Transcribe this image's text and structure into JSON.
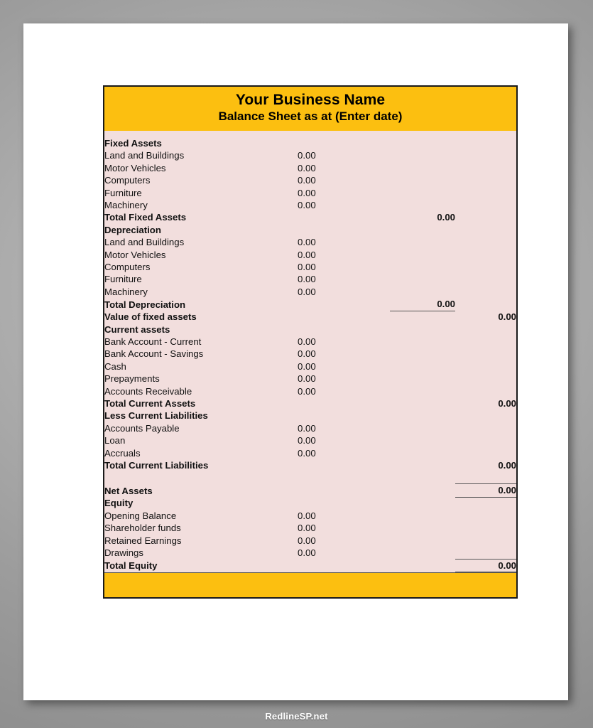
{
  "header": {
    "business_name": "Your Business Name",
    "subtitle": "Balance Sheet as at (Enter date)",
    "band_color": "#fcbf10",
    "body_color": "#f2dedd"
  },
  "sections": [
    {
      "title": "Fixed Assets",
      "rows": [
        {
          "label": "Land and Buildings",
          "detail": "0.00"
        },
        {
          "label": "Motor Vehicles",
          "detail": "0.00"
        },
        {
          "label": "Computers",
          "detail": "0.00"
        },
        {
          "label": "Furniture",
          "detail": "0.00"
        },
        {
          "label": "Machinery",
          "detail": "0.00"
        }
      ],
      "total": {
        "label": "Total Fixed Assets",
        "sub": "0.00"
      }
    },
    {
      "title": "Depreciation",
      "rows": [
        {
          "label": "Land and Buildings",
          "detail": "0.00"
        },
        {
          "label": "Motor Vehicles",
          "detail": "0.00"
        },
        {
          "label": "Computers",
          "detail": "0.00"
        },
        {
          "label": "Furniture",
          "detail": "0.00"
        },
        {
          "label": "Machinery",
          "detail": "0.00"
        }
      ],
      "total": {
        "label": "Total Depreciation",
        "sub": "0.00"
      },
      "grand": {
        "label": "Value of fixed assets",
        "total": "0.00"
      }
    },
    {
      "title": "Current assets",
      "rows": [
        {
          "label": "Bank Account - Current",
          "detail": "0.00"
        },
        {
          "label": "Bank Account - Savings",
          "detail": "0.00"
        },
        {
          "label": "Cash",
          "detail": "0.00"
        },
        {
          "label": "Prepayments",
          "detail": "0.00"
        },
        {
          "label": "Accounts Receivable",
          "detail": "0.00"
        }
      ],
      "total": {
        "label": "Total Current Assets",
        "total": "0.00"
      }
    },
    {
      "title": "Less Current Liabilities",
      "rows": [
        {
          "label": "Accounts Payable",
          "detail": "0.00"
        },
        {
          "label": "Loan",
          "detail": "0.00"
        },
        {
          "label": "Accruals",
          "detail": "0.00"
        }
      ],
      "total": {
        "label": "Total Current Liabilities",
        "total": "0.00"
      }
    },
    {
      "title": "Equity",
      "rows": [
        {
          "label": "Opening Balance",
          "detail": "0.00"
        },
        {
          "label": "Shareholder funds",
          "detail": "0.00"
        },
        {
          "label": "Retained Earnings",
          "detail": "0.00"
        },
        {
          "label": "Drawings",
          "detail": "0.00"
        }
      ]
    }
  ],
  "net_assets": {
    "label": "Net Assets",
    "total": "0.00"
  },
  "total_equity": {
    "label": "Total Equity",
    "total": "0.00"
  },
  "watermark": "RedlineSP.net"
}
